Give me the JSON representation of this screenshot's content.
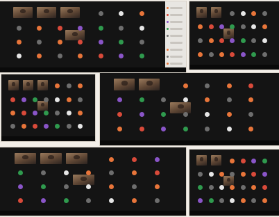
{
  "caption": "",
  "photos": [
    {
      "id": "p1",
      "kind": "left-panel"
    },
    {
      "id": "p2",
      "kind": "plain"
    },
    {
      "id": "p3",
      "kind": "plain"
    },
    {
      "id": "p4",
      "kind": "plain"
    },
    {
      "id": "p5",
      "kind": "plain"
    },
    {
      "id": "p6",
      "kind": "plain"
    }
  ],
  "colors": {
    "screen": "#141414",
    "orange": "#e8753a",
    "red": "#d94a3a",
    "purple": "#8a55c8",
    "green": "#2f9a4e",
    "grey": "#6e6e6e",
    "white": "#e6e6e6",
    "side_panel": "#e8e6e2"
  }
}
